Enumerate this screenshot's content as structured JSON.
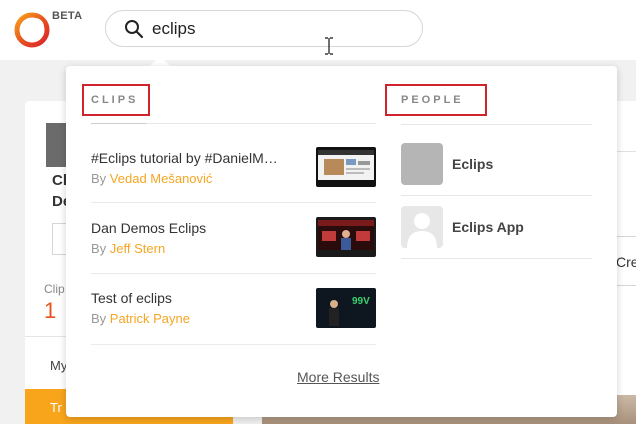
{
  "header": {
    "beta_label": "BETA",
    "search_value": "eclips",
    "search_placeholder": ""
  },
  "background": {
    "name_partial": "Cl\nDe",
    "clips_label_partial": "Clip",
    "clips_count": "1",
    "my_partial": "My",
    "orange_partial": "Tr",
    "right_button_partial": "Cre"
  },
  "dropdown": {
    "clips_heading": "CLIPS",
    "people_heading": "PEOPLE",
    "clips": [
      {
        "title": "#Eclips tutorial by #DanielM…",
        "by": "By",
        "author": "Vedad Mešanović"
      },
      {
        "title": "Dan Demos Eclips",
        "by": "By",
        "author": "Jeff Stern"
      },
      {
        "title": "Test of eclips",
        "by": "By",
        "author": "Patrick Payne"
      }
    ],
    "thumb3_overlay": "99V",
    "people": [
      {
        "name": "Eclips"
      },
      {
        "name": "Eclips App"
      }
    ],
    "more_results": "More Results"
  },
  "colors": {
    "accent": "#f5a623",
    "highlight_box": "#d0232c",
    "count": "#e8531e",
    "orange_bar": "#f8a51c"
  },
  "icons": {
    "logo": "eclips-logo-ring",
    "search": "search-icon",
    "cursor": "text-cursor-icon",
    "person_placeholder": "person-silhouette-icon"
  }
}
